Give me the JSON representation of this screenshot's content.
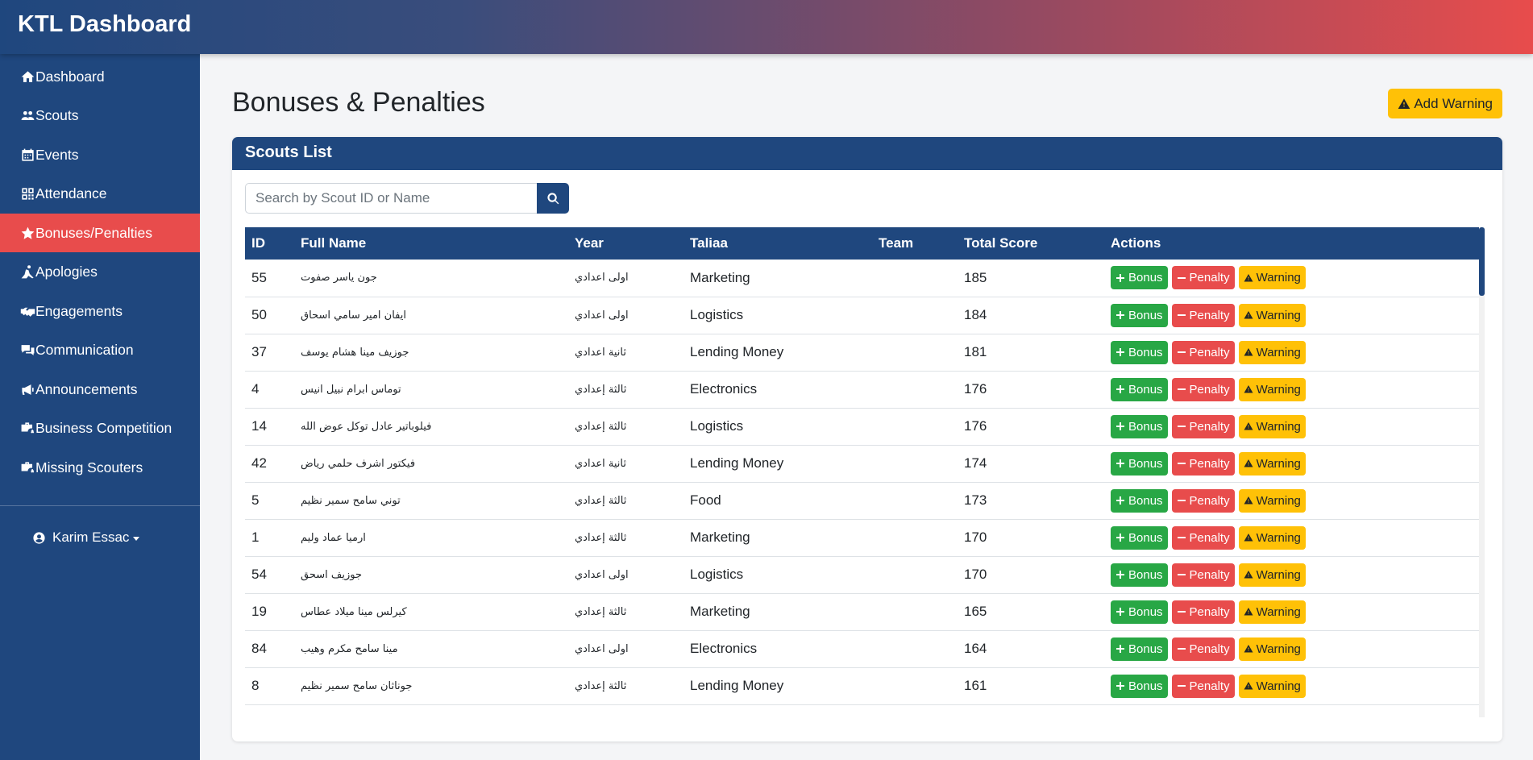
{
  "app": {
    "title": "KTL Dashboard"
  },
  "sidebar": {
    "items": [
      {
        "label": "Dashboard",
        "icon": "home-icon",
        "active": false
      },
      {
        "label": "Scouts",
        "icon": "users-icon",
        "active": false
      },
      {
        "label": "Events",
        "icon": "calendar-icon",
        "active": false
      },
      {
        "label": "Attendance",
        "icon": "qrcode-icon",
        "active": false
      },
      {
        "label": "Bonuses/Penalties",
        "icon": "star-icon",
        "active": true
      },
      {
        "label": "Apologies",
        "icon": "person-pray-icon",
        "active": false
      },
      {
        "label": "Engagements",
        "icon": "handshake-icon",
        "active": false
      },
      {
        "label": "Communication",
        "icon": "comments-icon",
        "active": false
      },
      {
        "label": "Announcements",
        "icon": "bullhorn-icon",
        "active": false
      },
      {
        "label": "Business Competition",
        "icon": "briefcase-cog-icon",
        "active": false
      },
      {
        "label": "Missing Scouters",
        "icon": "briefcase-cog-icon",
        "active": false
      }
    ],
    "user": "Karim Essac"
  },
  "page": {
    "title": "Bonuses & Penalties",
    "add_warning_label": "Add Warning"
  },
  "card": {
    "title": "Scouts List",
    "search_placeholder": "Search by Scout ID or Name"
  },
  "table": {
    "columns": [
      "ID",
      "Full Name",
      "Year",
      "Taliaa",
      "Team",
      "Total Score",
      "Actions"
    ],
    "actions": {
      "bonus": "Bonus",
      "penalty": "Penalty",
      "warning": "Warning"
    },
    "rows": [
      {
        "id": "55",
        "name": "جون ياسر صفوت",
        "year": "اولى اعدادي",
        "taliaa": "Marketing",
        "team": "",
        "score": "185"
      },
      {
        "id": "50",
        "name": "ايفان امير سامي اسحاق",
        "year": "اولى اعدادي",
        "taliaa": "Logistics",
        "team": "",
        "score": "184"
      },
      {
        "id": "37",
        "name": "جوزيف مينا هشام يوسف",
        "year": "ثانية اعدادي",
        "taliaa": "Lending Money",
        "team": "",
        "score": "181"
      },
      {
        "id": "4",
        "name": "توماس ابرام نبيل انيس",
        "year": "ثالثة إعدادي",
        "taliaa": "Electronics",
        "team": "",
        "score": "176"
      },
      {
        "id": "14",
        "name": "فيلوباتير عادل توكل عوض الله",
        "year": "ثالثة إعدادي",
        "taliaa": "Logistics",
        "team": "",
        "score": "176"
      },
      {
        "id": "42",
        "name": "فيكتور اشرف حلمي رياض",
        "year": "ثانية اعدادي",
        "taliaa": "Lending Money",
        "team": "",
        "score": "174"
      },
      {
        "id": "5",
        "name": "توني سامح سمير نظيم",
        "year": "ثالثة إعدادي",
        "taliaa": "Food",
        "team": "",
        "score": "173"
      },
      {
        "id": "1",
        "name": "ارميا عماد وليم",
        "year": "ثالثة إعدادي",
        "taliaa": "Marketing",
        "team": "",
        "score": "170"
      },
      {
        "id": "54",
        "name": "جوزيف اسحق",
        "year": "اولى اعدادي",
        "taliaa": "Logistics",
        "team": "",
        "score": "170"
      },
      {
        "id": "19",
        "name": "كيرلس مينا ميلاد عطاس",
        "year": "ثالثة إعدادي",
        "taliaa": "Marketing",
        "team": "",
        "score": "165"
      },
      {
        "id": "84",
        "name": "مينا سامح مكرم وهيب",
        "year": "اولى اعدادي",
        "taliaa": "Electronics",
        "team": "",
        "score": "164"
      },
      {
        "id": "8",
        "name": "جوناثان سامح سمير نظيم",
        "year": "ثالثة إعدادي",
        "taliaa": "Lending Money",
        "team": "",
        "score": "161"
      }
    ]
  },
  "colors": {
    "primary": "#1f477e",
    "danger": "#e84c4c",
    "success": "#28a745",
    "warning": "#ffc107"
  }
}
